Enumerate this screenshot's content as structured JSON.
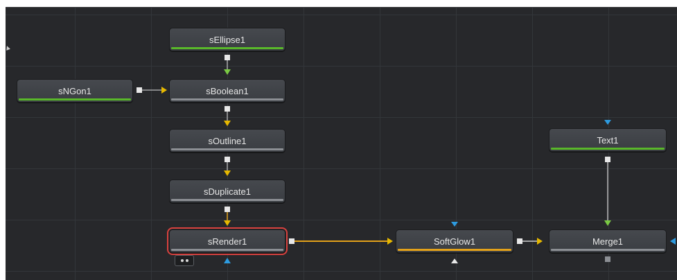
{
  "nodes": {
    "sellipse": "sEllipse1",
    "sngon": "sNGon1",
    "sboolean": "sBoolean1",
    "soutline": "sOutline1",
    "sduplicate": "sDuplicate1",
    "srender": "sRender1",
    "softglow": "SoftGlow1",
    "text": "Text1",
    "merge": "Merge1"
  },
  "colors": {
    "canvas": "#27282b",
    "shape_wire": "#e4a21a",
    "image_wire": "#d8d8d8",
    "input_yellow": "#e6b800",
    "input_green": "#7ac943",
    "input_blue": "#2d9be0",
    "selection": "#d8413e"
  }
}
